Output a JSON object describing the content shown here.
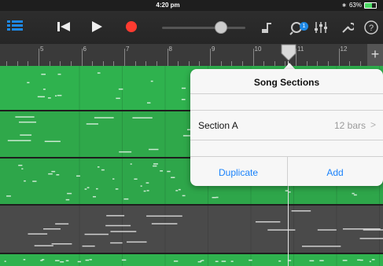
{
  "status": {
    "time": "4:20 pm",
    "battery_text": "63%",
    "bluetooth_glyph": "∗"
  },
  "toolbar": {
    "tracks_icon": "tracks-view-icon",
    "rewind_icon": "rewind-to-start-icon",
    "play_icon": "play-icon",
    "record_icon": "record-icon",
    "volume_level": 0.73,
    "notification_count": "1",
    "icons": [
      "note-settings-icon",
      "loops-icon",
      "mixer-icon",
      "wrench-icon",
      "help-icon"
    ],
    "colors": {
      "record": "#ff3b30",
      "tracks_active": "#1e88e5",
      "badge": "#1e88e5"
    }
  },
  "ruler": {
    "bars": [
      "5",
      "6",
      "7",
      "8",
      "9",
      "10",
      "11",
      "12"
    ],
    "plus_label": "+"
  },
  "popover": {
    "title": "Song Sections",
    "section_label": "Section A",
    "section_value": "12 bars",
    "chevron": ">",
    "duplicate_label": "Duplicate",
    "add_label": "Add",
    "accent": "#1a82fb"
  },
  "regions": [
    {
      "kind": "green",
      "color": "#2fb24e"
    },
    {
      "kind": "green",
      "color": "#2fa84a"
    },
    {
      "kind": "green",
      "color": "#2ea64a"
    },
    {
      "kind": "gray",
      "color": "#4a4a4a"
    },
    {
      "kind": "green",
      "color": "#2fb24e"
    }
  ]
}
